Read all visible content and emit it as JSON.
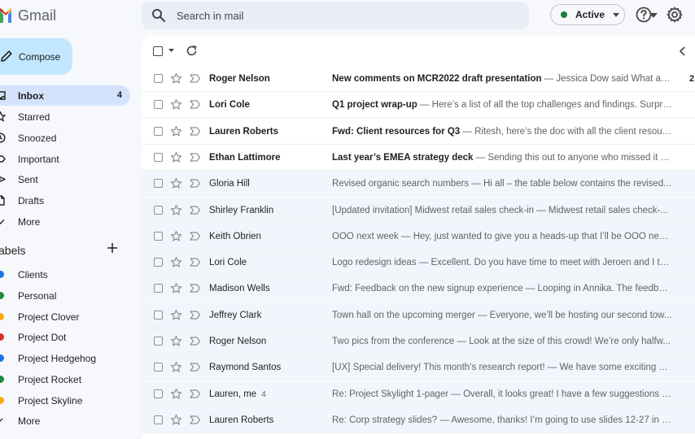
{
  "app": {
    "name": "Gmail",
    "colors": {
      "accent": "#c2e7ff",
      "active_nav": "#d3e3fd",
      "status_green": "#188038"
    }
  },
  "header": {
    "search_placeholder": "Search in mail",
    "status_label": "Active",
    "icons": [
      "search-icon",
      "caret-down-icon",
      "help-icon",
      "settings-gear-icon"
    ]
  },
  "sidebar": {
    "compose_label": "Compose",
    "nav": [
      {
        "label": "Inbox",
        "count": "4",
        "icon": "inbox-icon",
        "active": true
      },
      {
        "label": "Starred",
        "count": "",
        "icon": "star-icon",
        "active": false
      },
      {
        "label": "Snoozed",
        "count": "",
        "icon": "clock-icon",
        "active": false
      },
      {
        "label": "Important",
        "count": "",
        "icon": "important-icon",
        "active": false
      },
      {
        "label": "Sent",
        "count": "",
        "icon": "send-icon",
        "active": false
      },
      {
        "label": "Drafts",
        "count": "",
        "icon": "draft-icon",
        "active": false
      },
      {
        "label": "More",
        "count": "",
        "icon": "chevron-down-icon",
        "active": false
      }
    ],
    "labels_heading": "abels",
    "labels": [
      {
        "label": "Clients",
        "color": "#1a73e8"
      },
      {
        "label": "Personal",
        "color": "#1e8e3e"
      },
      {
        "label": "Project Clover",
        "color": "#f9ab00"
      },
      {
        "label": "Project Dot",
        "color": "#d93025"
      },
      {
        "label": "Project Hedgehog",
        "color": "#1a73e8"
      },
      {
        "label": "Project Rocket",
        "color": "#1e8e3e"
      },
      {
        "label": "Project Skyline",
        "color": "#f9ab00"
      }
    ],
    "labels_more": "More"
  },
  "emails": [
    {
      "sender": "Roger Nelson",
      "count": "",
      "subject": "New comments on MCR2022 draft presentation",
      "snippet": " — Jessica Dow said What ab...",
      "date": "2:",
      "unread": true
    },
    {
      "sender": "Lori Cole",
      "count": "",
      "subject": "Q1 project wrap-up",
      "snippet": " — Here’s a list of all the top challenges and findings. Surpri...",
      "date": "",
      "unread": true
    },
    {
      "sender": "Lauren Roberts",
      "count": "",
      "subject": "Fwd: Client resources for Q3",
      "snippet": " — Ritesh, here’s the doc with all the client resour...",
      "date": "",
      "unread": true
    },
    {
      "sender": "Ethan Lattimore",
      "count": "",
      "subject": "Last year’s EMEA strategy deck",
      "snippet": " — Sending this out to anyone who missed it R...",
      "date": "",
      "unread": true
    },
    {
      "sender": "Gloria Hill",
      "count": "",
      "subject": "Revised organic search numbers",
      "snippet": " — Hi all – the table below contains the revised...",
      "date": "",
      "unread": false
    },
    {
      "sender": "Shirley Franklin",
      "count": "",
      "subject": "[Updated invitation] Midwest retail sales check-in",
      "snippet": " — Midwest retail sales check-...",
      "date": "",
      "unread": false
    },
    {
      "sender": "Keith Obrien",
      "count": "",
      "subject": "OOO next week",
      "snippet": " — Hey, just wanted to give you a heads-up that I’ll be OOO next...",
      "date": "",
      "unread": false
    },
    {
      "sender": "Lori Cole",
      "count": "",
      "subject": "Logo redesign ideas",
      "snippet": " — Excellent. Do you have time to meet with Jeroen and I thi...",
      "date": "",
      "unread": false
    },
    {
      "sender": "Madison Wells",
      "count": "",
      "subject": "Fwd: Feedback on the new signup experience",
      "snippet": " — Looping in Annika. The feedbac...",
      "date": "",
      "unread": false
    },
    {
      "sender": "Jeffrey Clark",
      "count": "",
      "subject": "Town hall on the upcoming merger",
      "snippet": " — Everyone, we’ll be hosting our second tow...",
      "date": "",
      "unread": false
    },
    {
      "sender": "Roger Nelson",
      "count": "",
      "subject": "Two pics from the conference",
      "snippet": " — Look at the size of this crowd! We’re only halfw...",
      "date": "",
      "unread": false
    },
    {
      "sender": "Raymond Santos",
      "count": "",
      "subject": "[UX] Special delivery! This month’s research report!",
      "snippet": " — We have some exciting st...",
      "date": "",
      "unread": false
    },
    {
      "sender": "Lauren, me",
      "count": "4",
      "subject": "Re: Project Skylight 1-pager",
      "snippet": " — Overall, it looks great! I have a few suggestions fo...",
      "date": "",
      "unread": false
    },
    {
      "sender": "Lauren Roberts",
      "count": "",
      "subject": "Re: Corp strategy slides?",
      "snippet": " — Awesome, thanks! I’m going to use slides 12-27 in m...",
      "date": "",
      "unread": false
    }
  ]
}
